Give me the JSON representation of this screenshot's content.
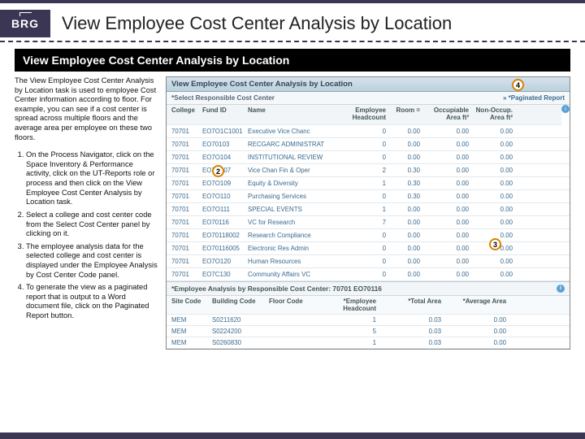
{
  "header": {
    "logo": "BRG",
    "title": "View Employee Cost Center Analysis by Location"
  },
  "subheader": "View Employee Cost Center Analysis by Location",
  "intro": "The View Employee Cost Center Analysis by Location task is used to employee Cost Center information according to floor. For example, you can see if a cost center is spread across multiple floors and the average area per employee on these two floors.",
  "steps": [
    "On the Process Navigator, click on the Space Inventory & Performance activity, click on the UT-Reports role or process and then click on the View Employee Cost Center Analysis by Location task.",
    "Select a college and cost center code from the Select Cost Center panel by clicking on it.",
    "The employee analysis data for the selected college and cost center is displayed under the Employee Analysis by Cost Center Code panel.",
    "To generate the view as a paginated report that is output to a Word document file, click on the Paginated Report button."
  ],
  "panel": {
    "title": "View Employee Cost Center Analysis by Location",
    "select_label": "*Select Responsible Cost Center",
    "paginated_label": "» *Paginated Report",
    "cols": {
      "college": "College",
      "fund": "Fund ID",
      "name": "Name",
      "head": "Employee Headcount",
      "room": "Room =",
      "occ": "Occupiable Area ft²",
      "nonocc": "Non-Occup. Area ft²"
    },
    "rows": [
      {
        "college": "70701",
        "fund": "EO7O1C1001",
        "name": "Executive Vice Chanc",
        "head": "0",
        "room": "0.00",
        "occ": "0.00",
        "nonocc": "0.00"
      },
      {
        "college": "70701",
        "fund": "EO70103",
        "name": "RECGARC ADMINISTRAT",
        "head": "0",
        "room": "0.00",
        "occ": "0.00",
        "nonocc": "0.00"
      },
      {
        "college": "70701",
        "fund": "EO7O104",
        "name": "INSTITUTIONAL REVIEW",
        "head": "0",
        "room": "0.00",
        "occ": "0.00",
        "nonocc": "0.00"
      },
      {
        "college": "70701",
        "fund": "EO7O107",
        "name": "Vice Chan Fin & Oper",
        "head": "2",
        "room": "0.30",
        "occ": "0.00",
        "nonocc": "0.00"
      },
      {
        "college": "70701",
        "fund": "EO7O109",
        "name": "Equity & Diversity",
        "head": "1",
        "room": "0.30",
        "occ": "0.00",
        "nonocc": "0.00"
      },
      {
        "college": "70701",
        "fund": "EO7O110",
        "name": "Purchasing Services",
        "head": "0",
        "room": "0.30",
        "occ": "0.00",
        "nonocc": "0.00"
      },
      {
        "college": "70701",
        "fund": "EO7O111",
        "name": "SPECIAL EVENTS",
        "head": "1",
        "room": "0.00",
        "occ": "0.00",
        "nonocc": "0.00"
      },
      {
        "college": "70701",
        "fund": "EO70116",
        "name": "VC for Research",
        "head": "7",
        "room": "0.00",
        "occ": "0.00",
        "nonocc": "0.00"
      },
      {
        "college": "70701",
        "fund": "EO70118002",
        "name": "Research Compliance",
        "head": "0",
        "room": "0.00",
        "occ": "0.00",
        "nonocc": "0.00"
      },
      {
        "college": "70701",
        "fund": "EO70116005",
        "name": "Electronic Res Admin",
        "head": "0",
        "room": "0.00",
        "occ": "0.00",
        "nonocc": "0.00"
      },
      {
        "college": "70701",
        "fund": "EO7O120",
        "name": "Human Resources",
        "head": "0",
        "room": "0.00",
        "occ": "0.00",
        "nonocc": "0.00"
      },
      {
        "college": "70701",
        "fund": "EO7C130",
        "name": "Community Affairs VC",
        "head": "0",
        "room": "0.00",
        "occ": "0.00",
        "nonocc": "0.00"
      }
    ],
    "bottom_title": "*Employee Analysis by Responsible Cost Center: 70701 EO70116",
    "bcols": {
      "site": "Site Code",
      "bldg": "Building Code",
      "floor": "Floor Code",
      "head": "*Employee Headcount",
      "tarea": "*Total Area",
      "avg": "*Average Area"
    },
    "brows": [
      {
        "site": "MEM",
        "bldg": "S0211620",
        "floor": "",
        "head": "1",
        "tarea": "0.03",
        "avg": "0.00"
      },
      {
        "site": "MEM",
        "bldg": "S0224200",
        "floor": "",
        "head": "5",
        "tarea": "0.03",
        "avg": "0.00"
      },
      {
        "site": "MEM",
        "bldg": "S0260830",
        "floor": "",
        "head": "1",
        "tarea": "0.03",
        "avg": "0.00"
      }
    ]
  },
  "callouts": {
    "c2": "2",
    "c3": "3",
    "c4": "4"
  }
}
